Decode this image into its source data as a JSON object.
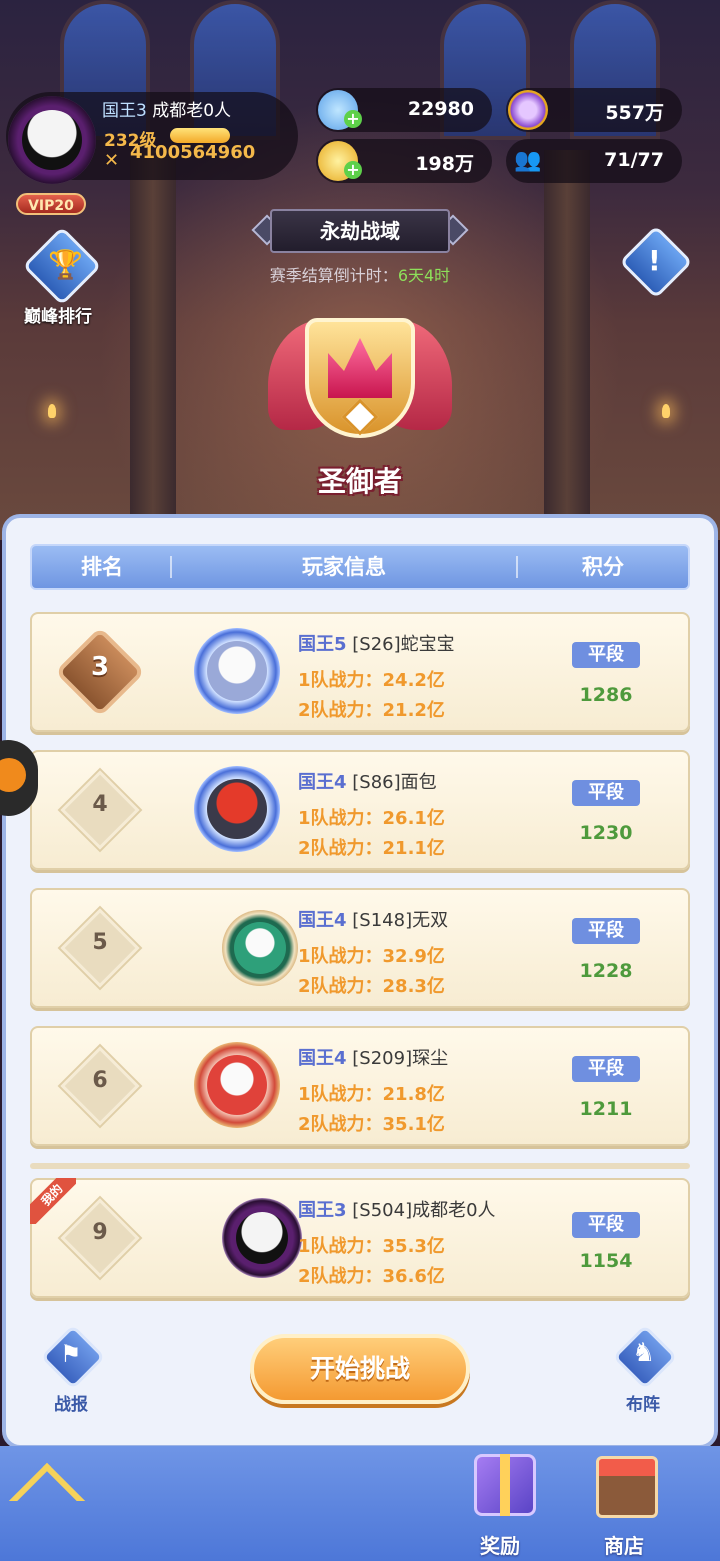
{
  "player": {
    "title": "国王3",
    "name": "成都老0人",
    "level": "232级",
    "power": "4100564960",
    "vip": "VIP20"
  },
  "resources": {
    "diamond": "22980",
    "gold": "198万",
    "orb": "557万",
    "members": "71/77"
  },
  "mode": {
    "title": "永劫战域",
    "countdown_label": "赛季结算倒计时：",
    "countdown_value": "6天4时",
    "rank_title": "圣御者"
  },
  "side": {
    "peak_rank": "巅峰排行"
  },
  "table": {
    "col_rank": "排名",
    "col_info": "玩家信息",
    "col_score": "积分",
    "rows": [
      {
        "rank": "3",
        "title": "国王5",
        "name": "[S26]蛇宝宝",
        "team1": "1队战力：24.2亿",
        "team2": "2队战力：21.2亿",
        "badge": "平段",
        "score": "1286"
      },
      {
        "rank": "4",
        "title": "国王4",
        "name": "[S86]面包",
        "team1": "1队战力：26.1亿",
        "team2": "2队战力：21.1亿",
        "badge": "平段",
        "score": "1230"
      },
      {
        "rank": "5",
        "title": "国王4",
        "name": "[S148]无双",
        "team1": "1队战力：32.9亿",
        "team2": "2队战力：28.3亿",
        "badge": "平段",
        "score": "1228"
      },
      {
        "rank": "6",
        "title": "国王4",
        "name": "[S209]琛尘",
        "team1": "1队战力：21.8亿",
        "team2": "2队战力：35.1亿",
        "badge": "平段",
        "score": "1211"
      }
    ],
    "mine": {
      "tag": "我的",
      "rank": "9",
      "title": "国王3",
      "name": "[S504]成都老0人",
      "team1": "1队战力：35.3亿",
      "team2": "2队战力：36.6亿",
      "badge": "平段",
      "score": "1154"
    }
  },
  "actions": {
    "report": "战报",
    "start": "开始挑战",
    "formation": "布阵"
  },
  "nav": {
    "reward": "奖励",
    "shop": "商店"
  }
}
